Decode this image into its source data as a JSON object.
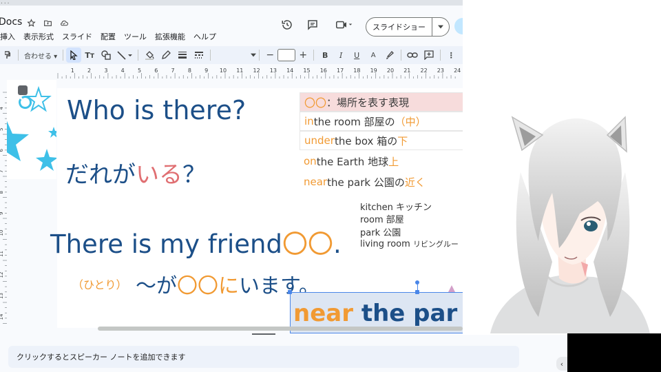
{
  "app": {
    "name": "Docs",
    "url_fragment": "..."
  },
  "menu": [
    "挿入",
    "表示形式",
    "スライド",
    "配置",
    "ツール",
    "拡張機能",
    "ヘルプ"
  ],
  "header": {
    "slideshow_label": "スライドショー"
  },
  "toolbar": {
    "zoom_label": "合わせる",
    "font_size_value": ""
  },
  "ruler": {
    "h_labels": [
      "1",
      "2",
      "3",
      "4",
      "5",
      "6",
      "7",
      "8",
      "9",
      "10",
      "11",
      "12",
      "13",
      "14",
      "15",
      "16",
      "17",
      "18",
      "19",
      "20",
      "21",
      "22",
      "23",
      "24"
    ],
    "v_labels": [
      "4",
      "5",
      "6",
      "7",
      "8",
      "9",
      "10",
      "11",
      "12",
      "13",
      "14"
    ]
  },
  "slide": {
    "q_title": "Who is there?",
    "q_jp_prefix": "だれが",
    "q_jp_highlight": "いる",
    "q_jp_suffix": "？",
    "answer_en_prefix": "There is my friend",
    "answer_en_circles": "〇〇",
    "answer_en_period": ".",
    "reading_hitori": "（ひとり）",
    "jp_pattern_a": "～が",
    "jp_pattern_circles": "〇〇",
    "jp_pattern_ni": "に",
    "jp_pattern_end": "います。",
    "table_header_circles": "〇〇",
    "table_header_rest": "：場所を表す表現",
    "rows": [
      {
        "prep": "in",
        "rest": " the room 部屋の",
        "jp_hl": "（中）"
      },
      {
        "prep": "under",
        "rest": " the box 箱の",
        "jp_hl": "下"
      },
      {
        "prep": "on",
        "rest": " the Earth 地球",
        "jp_hl": "上"
      },
      {
        "prep": "near",
        "rest": " the park 公園の",
        "jp_hl": "近く"
      }
    ],
    "vocab": [
      {
        "en": "kitchen",
        "jp": "キッチン"
      },
      {
        "en": "room",
        "jp": "部屋"
      },
      {
        "en": "park",
        "jp": "公園"
      },
      {
        "en": "living room",
        "jp": "リビングルー"
      }
    ],
    "big_near": "near",
    "big_rest": " the par"
  },
  "notes": {
    "placeholder": "クリックするとスピーカー ノートを追加できます"
  },
  "colors": {
    "title_blue": "#1c4f88",
    "accent_orange": "#f19a33",
    "accent_pink": "#e06f72",
    "star_cyan": "#3ec0e8",
    "ui_blue": "#4a86e8"
  }
}
